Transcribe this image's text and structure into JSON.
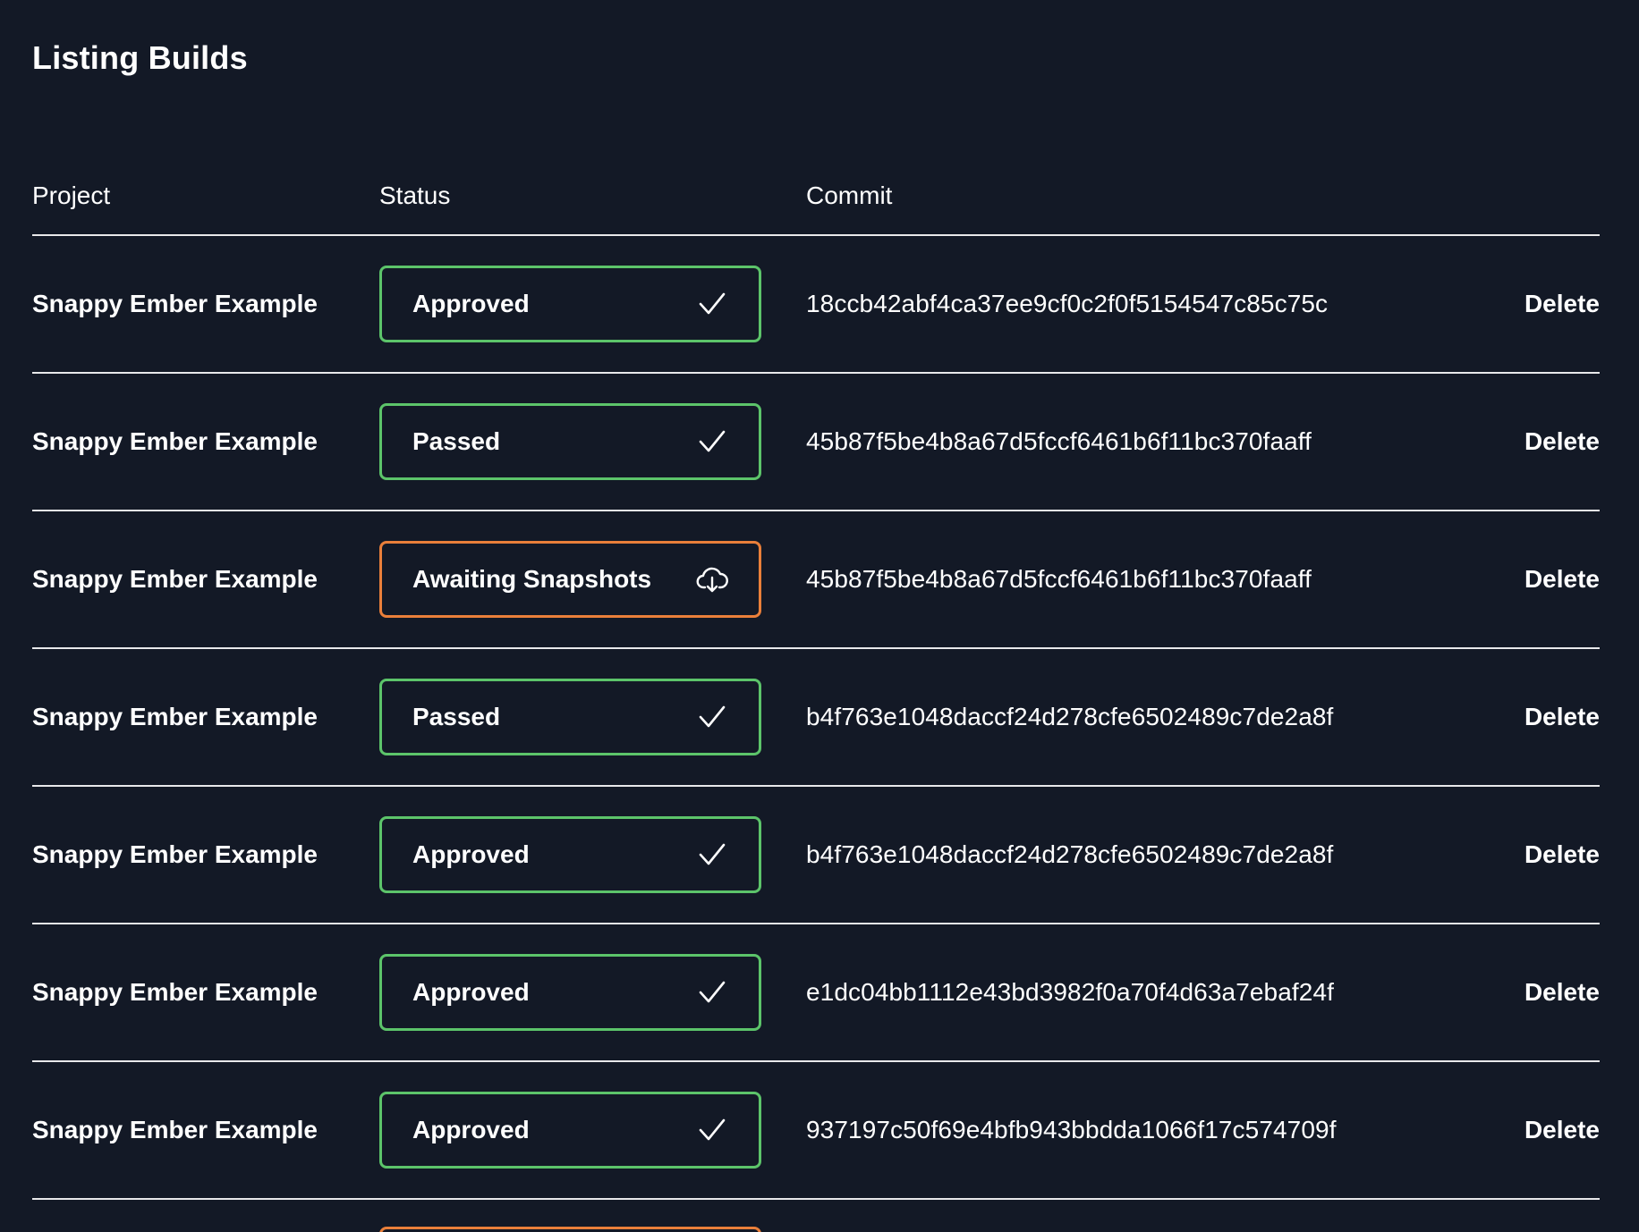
{
  "page": {
    "title": "Listing Builds"
  },
  "table": {
    "headers": {
      "project": "Project",
      "status": "Status",
      "commit": "Commit"
    },
    "rows": [
      {
        "project": "Snappy Ember Example",
        "status": "Approved",
        "status_icon": "check-icon",
        "commit": "18ccb42abf4ca37ee9cf0c2f0f5154547c85c75c",
        "action": "Delete"
      },
      {
        "project": "Snappy Ember Example",
        "status": "Passed",
        "status_icon": "check-icon",
        "commit": "45b87f5be4b8a67d5fccf6461b6f11bc370faaff",
        "action": "Delete"
      },
      {
        "project": "Snappy Ember Example",
        "status": "Awaiting Snapshots",
        "status_icon": "cloud-download-icon",
        "commit": "45b87f5be4b8a67d5fccf6461b6f11bc370faaff",
        "action": "Delete"
      },
      {
        "project": "Snappy Ember Example",
        "status": "Passed",
        "status_icon": "check-icon",
        "commit": "b4f763e1048daccf24d278cfe6502489c7de2a8f",
        "action": "Delete"
      },
      {
        "project": "Snappy Ember Example",
        "status": "Approved",
        "status_icon": "check-icon",
        "commit": "b4f763e1048daccf24d278cfe6502489c7de2a8f",
        "action": "Delete"
      },
      {
        "project": "Snappy Ember Example",
        "status": "Approved",
        "status_icon": "check-icon",
        "commit": "e1dc04bb1112e43bd3982f0a70f4d63a7ebaf24f",
        "action": "Delete"
      },
      {
        "project": "Snappy Ember Example",
        "status": "Approved",
        "status_icon": "check-icon",
        "commit": "937197c50f69e4bfb943bbdda1066f17c574709f",
        "action": "Delete"
      }
    ]
  },
  "colors": {
    "background": "#131926",
    "success": "#5cc46a",
    "pending": "#ea7f3a",
    "text": "#ffffff"
  }
}
